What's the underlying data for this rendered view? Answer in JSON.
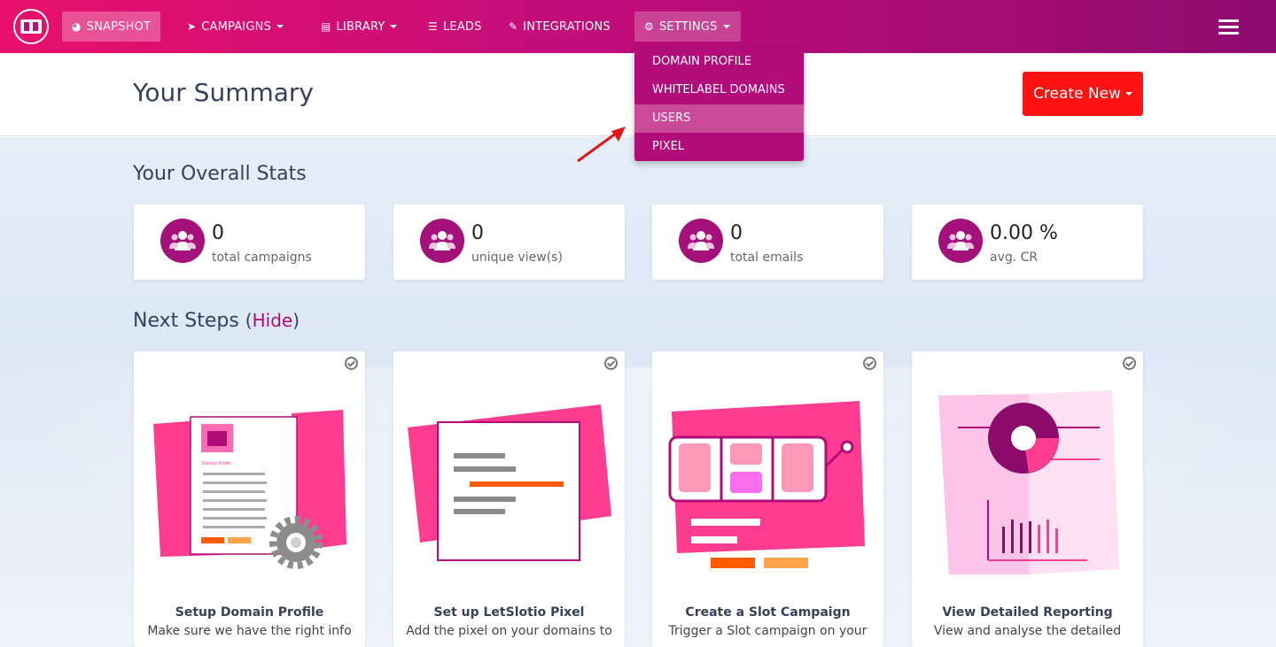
{
  "nav": {
    "items": [
      {
        "label": "SNAPSHOT",
        "icon": "dashboard-icon"
      },
      {
        "label": "CAMPAIGNS",
        "icon": "paper-plane-icon"
      },
      {
        "label": "LIBRARY",
        "icon": "library-icon"
      },
      {
        "label": "LEADS",
        "icon": "list-icon"
      },
      {
        "label": "INTEGRATIONS",
        "icon": "plug-icon"
      },
      {
        "label": "SETTINGS",
        "icon": "gears-icon"
      }
    ]
  },
  "settings_menu": {
    "items": [
      "DOMAIN PROFILE",
      "WHITELABEL DOMAINS",
      "USERS",
      "PIXEL"
    ]
  },
  "header": {
    "title": "Your Summary",
    "create_label": "Create New"
  },
  "stats": {
    "title": "Your Overall Stats",
    "cards": [
      {
        "value": "0",
        "label": "total campaigns"
      },
      {
        "value": "0",
        "label": "unique view(s)"
      },
      {
        "value": "0",
        "label": "total emails"
      },
      {
        "value": "0.00 %",
        "label": "avg. CR"
      }
    ]
  },
  "next_steps": {
    "title": "Next Steps",
    "hide_open": "(",
    "hide_label": "Hide",
    "hide_close": ")",
    "cards": [
      {
        "title": "Setup Domain Profile",
        "desc": "Make sure we have the right info",
        "illus_label": "Domain Profile"
      },
      {
        "title": "Set up LetSlotio Pixel",
        "desc": "Add the pixel on your domains to"
      },
      {
        "title": "Create a Slot Campaign",
        "desc": "Trigger a Slot campaign on your"
      },
      {
        "title": "View Detailed Reporting",
        "desc": "View and analyse the detailed"
      }
    ]
  },
  "colors": {
    "brand": "#b20c7a",
    "create": "#fe1212",
    "pink": "#fe3d91"
  }
}
